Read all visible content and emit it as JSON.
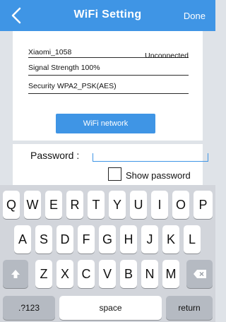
{
  "header": {
    "title": "WiFi Setting",
    "done_label": "Done",
    "back_icon": "chevron-left-icon"
  },
  "wifi": {
    "ssid": "Xiaomi_1058",
    "status": "Unconnected",
    "signal": "Signal Strength 100%",
    "security": "Security WPA2_PSK(AES)",
    "network_button": "WiFi network"
  },
  "password": {
    "label": "Password :",
    "value": "",
    "show_label": "Show password",
    "show_checked": false
  },
  "keyboard": {
    "row1": [
      "Q",
      "W",
      "E",
      "R",
      "T",
      "Y",
      "U",
      "I",
      "O",
      "P"
    ],
    "row2": [
      "A",
      "S",
      "D",
      "F",
      "G",
      "H",
      "J",
      "K",
      "L"
    ],
    "row3": [
      "Z",
      "X",
      "C",
      "V",
      "B",
      "N",
      "M"
    ],
    "shift_icon": "shift-arrow-icon",
    "backspace_icon": "backspace-icon",
    "numbers_label": ".?123",
    "space_label": "space",
    "return_label": "return"
  },
  "colors": {
    "accent": "#3f95e5",
    "background": "#dfe3e8",
    "keyboard": "#d2d5db"
  }
}
